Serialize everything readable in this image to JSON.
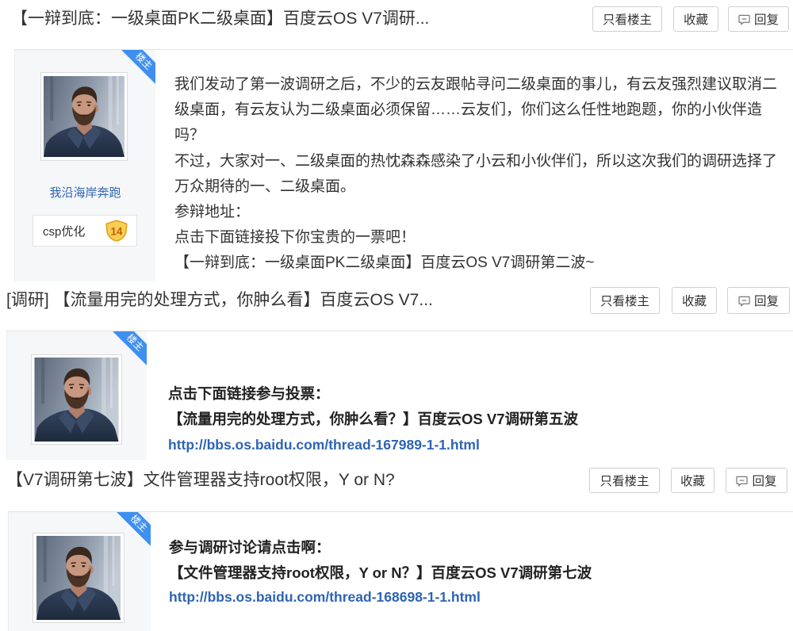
{
  "icons": {
    "reply_button": "comment-icon",
    "level_badge": "shield-icon",
    "avatar": "portrait-photo"
  },
  "colors": {
    "text": "#333333",
    "link_blue": "#2d64b3",
    "op_ribbon_blue": "#3f8ff0",
    "level_gold": "#f8cf55",
    "button_border": "#cfcfcf"
  },
  "threads": [
    {
      "title": "【一辩到底：一级桌面PK二级桌面】百度云OS V7调研...",
      "actions": {
        "only_op": "只看楼主",
        "favorite": "收藏",
        "reply": "回复"
      },
      "post": {
        "op_badge": "楼主",
        "author": {
          "name": "我沿海岸奔跑",
          "tag": "csp优化",
          "level": "14"
        },
        "lines": [
          "我们发动了第一波调研之后，不少的云友跟帖寻问二级桌面的事儿，有云友强烈建议取消二",
          "级桌面，有云友认为二级桌面必须保留……云友们，你们这么任性地跑题，你的小伙伴造",
          "吗？",
          "不过，大家对一、二级桌面的热忱森森感染了小云和小伙伴们，所以这次我们的调研选择了",
          "万众期待的一、二级桌面。",
          "参辩地址：",
          "点击下面链接投下你宝贵的一票吧！",
          "【一辩到底：一级桌面PK二级桌面】百度云OS V7调研第二波~"
        ]
      }
    },
    {
      "title": "[调研] 【流量用完的处理方式，你肿么看】百度云OS V7...",
      "actions": {
        "only_op": "只看楼主",
        "favorite": "收藏",
        "reply": "回复"
      },
      "post": {
        "op_badge": "楼主",
        "lines": [
          "点击下面链接参与投票：",
          "【流量用完的处理方式，你肿么看？】百度云OS V7调研第五波"
        ],
        "link": "http://bbs.os.baidu.com/thread-167989-1-1.html"
      }
    },
    {
      "title": "【V7调研第七波】文件管理器支持root权限，Y or N?",
      "actions": {
        "only_op": "只看楼主",
        "favorite": "收藏",
        "reply": "回复"
      },
      "post": {
        "op_badge": "楼主",
        "lines": [
          "参与调研讨论请点击啊：",
          "【文件管理器支持root权限，Y or N？】百度云OS V7调研第七波"
        ],
        "link": "http://bbs.os.baidu.com/thread-168698-1-1.html"
      }
    }
  ]
}
